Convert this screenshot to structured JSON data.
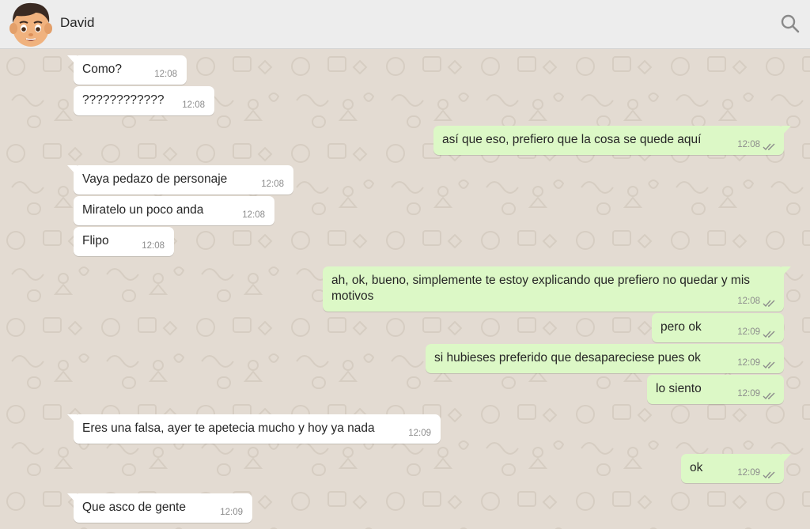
{
  "header": {
    "contact_name": "David",
    "avatar_icon": "boy-emoji-avatar",
    "search_icon": "search-icon"
  },
  "colors": {
    "header_bg": "#ededed",
    "wallpaper_bg": "#e3dbd2",
    "incoming_bubble": "#ffffff",
    "outgoing_bubble": "#dcf8c6",
    "timestamp": "#8c8c8c",
    "read_ticks": "#8c8c8c"
  },
  "messages": [
    {
      "direction": "in",
      "text": "Como?",
      "time": "12:08"
    },
    {
      "direction": "in",
      "text": "????????????",
      "time": "12:08"
    },
    {
      "direction": "out",
      "text": "así que eso, prefiero que la cosa se quede aquí",
      "time": "12:08",
      "status": "double-check-icon"
    },
    {
      "direction": "in",
      "text": "Vaya pedazo de personaje",
      "time": "12:08"
    },
    {
      "direction": "in",
      "text": "Miratelo un poco anda",
      "time": "12:08"
    },
    {
      "direction": "in",
      "text": "Flipo",
      "time": "12:08"
    },
    {
      "direction": "out",
      "text": "ah, ok, bueno, simplemente te estoy explicando que prefiero no quedar y mis motivos",
      "time": "12:08",
      "status": "double-check-icon"
    },
    {
      "direction": "out",
      "text": "pero ok",
      "time": "12:09",
      "status": "double-check-icon"
    },
    {
      "direction": "out",
      "text": "si hubieses preferido que desapareciese pues ok",
      "time": "12:09",
      "status": "double-check-icon"
    },
    {
      "direction": "out",
      "text": "lo siento",
      "time": "12:09",
      "status": "double-check-icon"
    },
    {
      "direction": "in",
      "text": "Eres una falsa, ayer te apetecia mucho y hoy ya nada",
      "time": "12:09"
    },
    {
      "direction": "out",
      "text": "ok",
      "time": "12:09",
      "status": "double-check-icon"
    },
    {
      "direction": "in",
      "text": "Que asco de gente",
      "time": "12:09"
    }
  ]
}
